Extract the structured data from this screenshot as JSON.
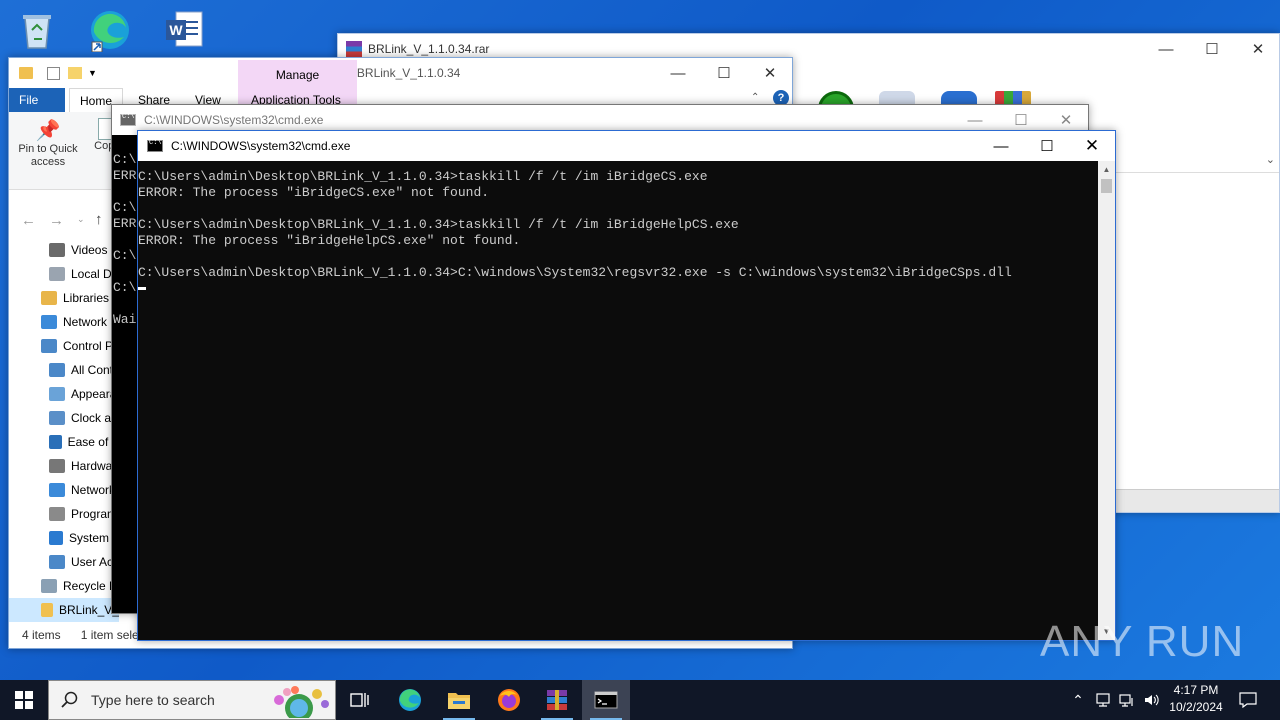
{
  "desktop": {
    "icons": [
      "recycle-bin-icon",
      "edge-icon",
      "word-icon"
    ]
  },
  "winrar": {
    "title": "BRLink_V_1.1.0.34.rar"
  },
  "explorer": {
    "title": "BRLink_V_1.1.0.34",
    "tabs": {
      "file": "File",
      "home": "Home",
      "share": "Share",
      "view": "View",
      "app_tools": "Application Tools"
    },
    "manage": "Manage",
    "ribbon": {
      "pin": "Pin to Quick access",
      "copy": "Copy"
    },
    "tree": [
      {
        "label": "Videos",
        "color": "#6a6a6a"
      },
      {
        "label": "Local Di",
        "color": "#9aa4b0"
      },
      {
        "label": "Libraries",
        "color": "#e8b54a"
      },
      {
        "label": "Network",
        "color": "#3b8ad9"
      },
      {
        "label": "Control P",
        "color": "#4b88c8"
      },
      {
        "label": "All Conti",
        "color": "#4b88c8"
      },
      {
        "label": "Appeara",
        "color": "#6aa3d8"
      },
      {
        "label": "Clock ar",
        "color": "#5a8fc8"
      },
      {
        "label": "Ease of A",
        "color": "#2a6fb8"
      },
      {
        "label": "Hardwa",
        "color": "#777777"
      },
      {
        "label": "Network",
        "color": "#3b8ad9"
      },
      {
        "label": "Program",
        "color": "#8a8a8a"
      },
      {
        "label": "System a",
        "color": "#2a7ad0"
      },
      {
        "label": "User Acc",
        "color": "#4b88c8"
      },
      {
        "label": "Recycle B",
        "color": "#8aa0b4"
      },
      {
        "label": "BRLink_V_",
        "color": "#f0c050"
      }
    ],
    "status": {
      "items": "4 items",
      "selected": "1 item sele"
    }
  },
  "cmd_back": {
    "title": "C:\\WINDOWS\\system32\\cmd.exe",
    "lines": [
      "C:\\",
      "ERRO",
      "C:\\",
      "ERRO",
      "C:\\",
      "C:\\",
      "Wai"
    ]
  },
  "cmd_front": {
    "title": "C:\\WINDOWS\\system32\\cmd.exe",
    "lines": [
      "C:\\Users\\admin\\Desktop\\BRLink_V_1.1.0.34>taskkill /f /t /im iBridgeCS.exe",
      "ERROR: The process \"iBridgeCS.exe\" not found.",
      "",
      "C:\\Users\\admin\\Desktop\\BRLink_V_1.1.0.34>taskkill /f /t /im iBridgeHelpCS.exe",
      "ERROR: The process \"iBridgeHelpCS.exe\" not found.",
      "",
      "C:\\Users\\admin\\Desktop\\BRLink_V_1.1.0.34>C:\\windows\\System32\\regsvr32.exe -s C:\\windows\\system32\\iBridgeCSps.dll"
    ]
  },
  "watermark": "ANY RUN",
  "taskbar": {
    "search_placeholder": "Type here to search",
    "time": "4:17 PM",
    "date": "10/2/2024"
  },
  "colors": {
    "accent": "#1c63b7",
    "taskbar": "#101727",
    "desktop": "#1565d0"
  }
}
